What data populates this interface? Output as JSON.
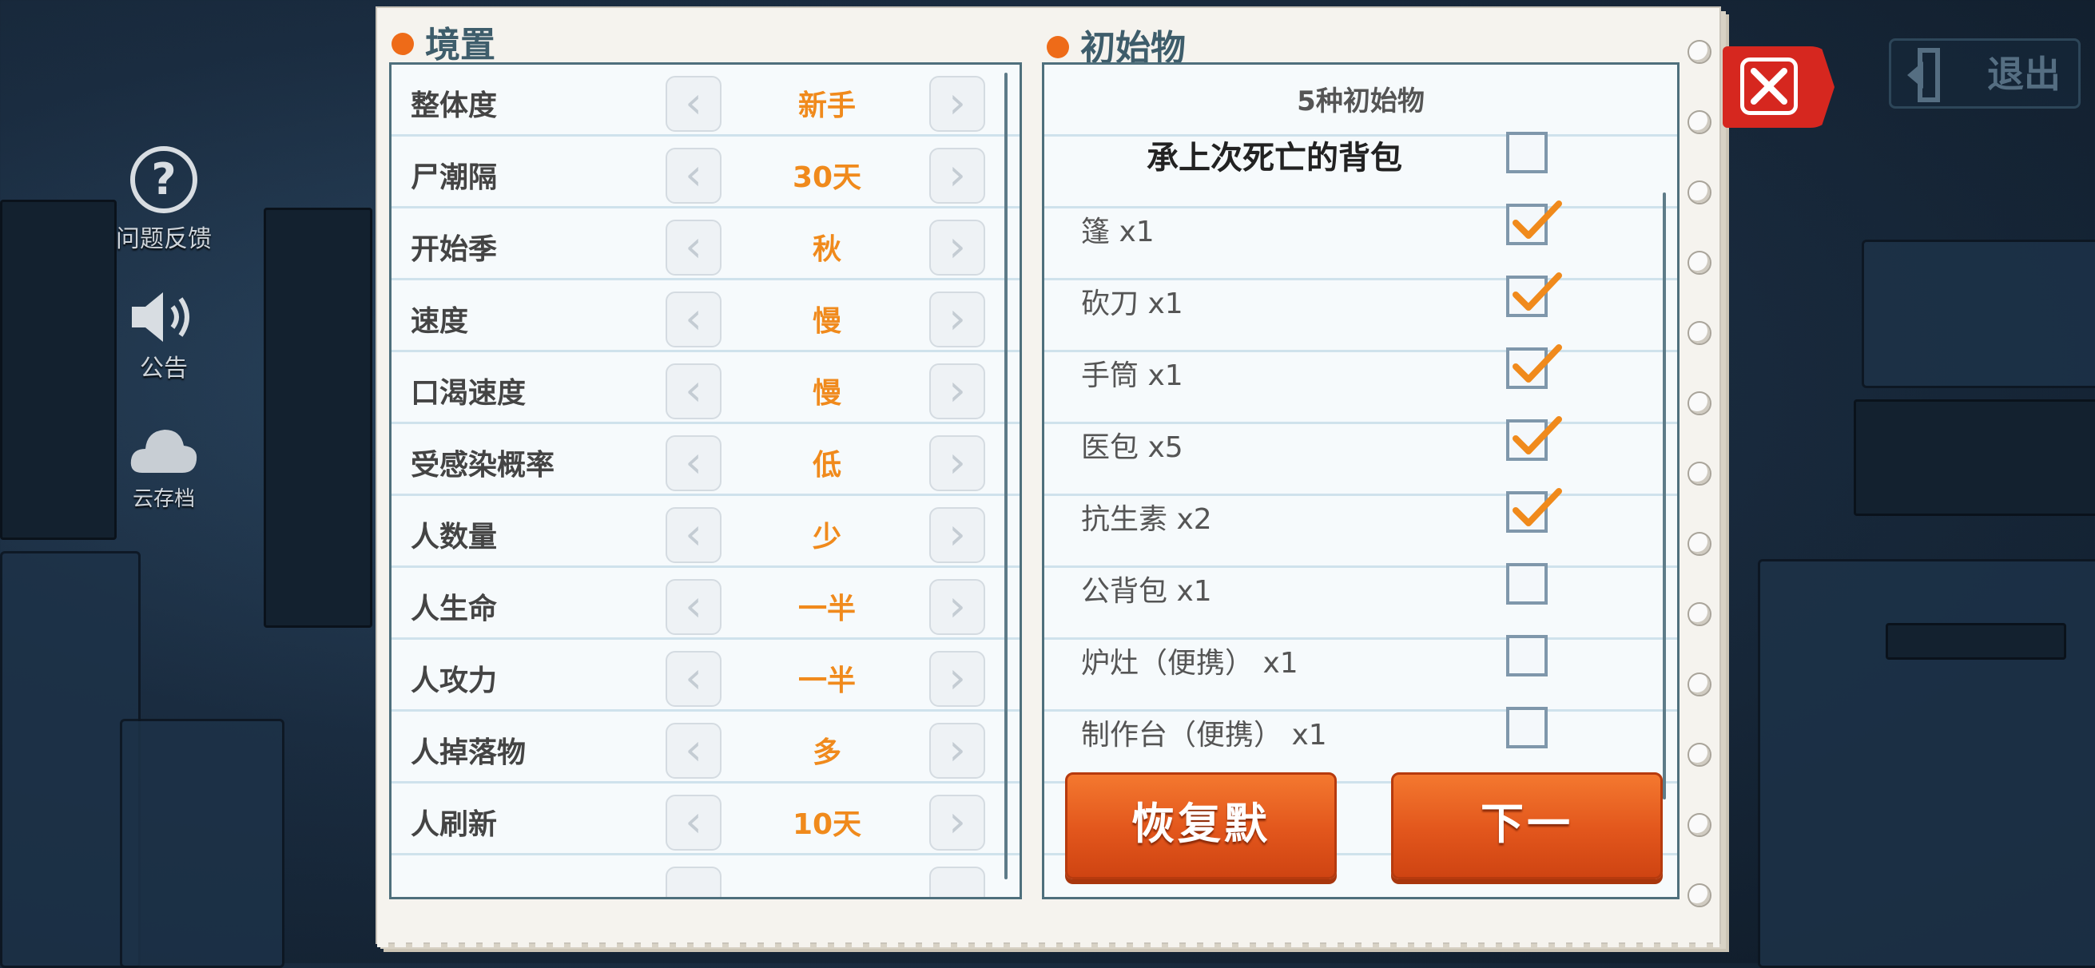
{
  "sidebar": {
    "feedback_label": "问题反馈",
    "announce_label": "公告",
    "cloud_label": "云存档"
  },
  "exit_label": "退出",
  "settings": {
    "title": "境置",
    "rows": [
      {
        "name": "整体度",
        "value": "新手"
      },
      {
        "name": "尸潮隔",
        "value": "30天"
      },
      {
        "name": "开始季",
        "value": "秋"
      },
      {
        "name": "速度",
        "value": "慢"
      },
      {
        "name": "口渴速度",
        "value": "慢"
      },
      {
        "name": "受感染概率",
        "value": "低"
      },
      {
        "name": "人数量",
        "value": "少"
      },
      {
        "name": "人生命",
        "value": "一半"
      },
      {
        "name": "人攻力",
        "value": "一半"
      },
      {
        "name": "人掉落物",
        "value": "多"
      },
      {
        "name": "人刷新",
        "value": "10天"
      }
    ]
  },
  "items": {
    "title": "初始物",
    "count_label": "5种初始物",
    "inherit_label": "承上次死亡的背包",
    "inherit_checked": false,
    "rows": [
      {
        "name": "篷 x1",
        "checked": true
      },
      {
        "name": "砍刀 x1",
        "checked": true
      },
      {
        "name": "手筒 x1",
        "checked": true
      },
      {
        "name": "医包 x5",
        "checked": true
      },
      {
        "name": "抗生素 x2",
        "checked": true
      },
      {
        "name": "公背包 x1",
        "checked": false
      },
      {
        "name": "炉灶（便携） x1",
        "checked": false
      },
      {
        "name": "制作台（便携） x1",
        "checked": false
      }
    ],
    "reset_label": "恢复默",
    "next_label": "下一"
  },
  "colors": {
    "accent_orange": "#f08a1c",
    "button_orange": "#e2561c",
    "close_red": "#d6271f",
    "title_teal": "#3e5d6b"
  }
}
